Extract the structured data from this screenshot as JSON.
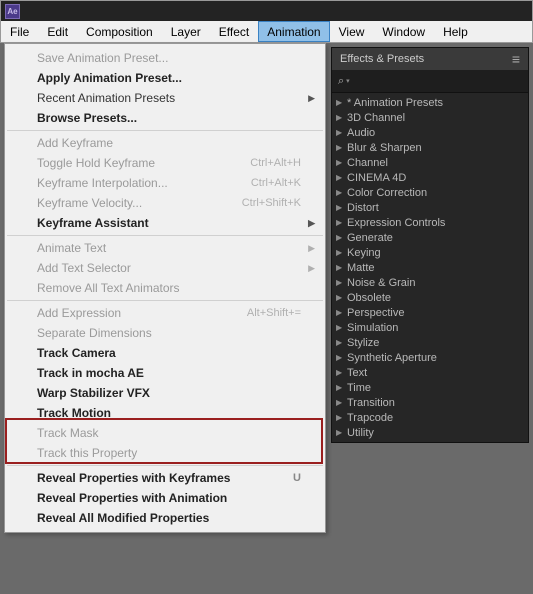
{
  "app_icon": "Ae",
  "menubar": {
    "items": [
      "File",
      "Edit",
      "Composition",
      "Layer",
      "Effect",
      "Animation",
      "View",
      "Window",
      "Help"
    ],
    "active_index": 5
  },
  "dropdown": {
    "groups": [
      [
        {
          "label": "Save Animation Preset...",
          "disabled": true
        },
        {
          "label": "Apply Animation Preset...",
          "bold": true
        },
        {
          "label": "Recent Animation Presets",
          "submenu": true
        },
        {
          "label": "Browse Presets...",
          "bold": true
        }
      ],
      [
        {
          "label": "Add Keyframe",
          "disabled": true
        },
        {
          "label": "Toggle Hold Keyframe",
          "disabled": true,
          "shortcut": "Ctrl+Alt+H"
        },
        {
          "label": "Keyframe Interpolation...",
          "disabled": true,
          "shortcut": "Ctrl+Alt+K"
        },
        {
          "label": "Keyframe Velocity...",
          "disabled": true,
          "shortcut": "Ctrl+Shift+K"
        },
        {
          "label": "Keyframe Assistant",
          "bold": true,
          "submenu": true
        }
      ],
      [
        {
          "label": "Animate Text",
          "disabled": true,
          "submenu": true
        },
        {
          "label": "Add Text Selector",
          "disabled": true,
          "submenu": true
        },
        {
          "label": "Remove All Text Animators",
          "disabled": true
        }
      ],
      [
        {
          "label": "Add Expression",
          "disabled": true,
          "shortcut": "Alt+Shift+="
        },
        {
          "label": "Separate Dimensions",
          "disabled": true
        },
        {
          "label": "Track Camera",
          "bold": true
        },
        {
          "label": "Track in mocha AE",
          "bold": true
        },
        {
          "label": "Warp Stabilizer VFX",
          "bold": true
        },
        {
          "label": "Track Motion",
          "bold": true
        },
        {
          "label": "Track Mask",
          "disabled": true
        },
        {
          "label": "Track this Property",
          "disabled": true
        }
      ],
      [
        {
          "label": "Reveal Properties with Keyframes",
          "bold": true,
          "shortcut": "U"
        },
        {
          "label": "Reveal Properties with Animation",
          "bold": true
        },
        {
          "label": "Reveal All Modified Properties",
          "bold": true
        }
      ]
    ]
  },
  "panel": {
    "title": "Effects & Presets",
    "items": [
      {
        "label": "Animation Presets",
        "special": true
      },
      {
        "label": "3D Channel"
      },
      {
        "label": "Audio"
      },
      {
        "label": "Blur & Sharpen"
      },
      {
        "label": "Channel"
      },
      {
        "label": "CINEMA 4D"
      },
      {
        "label": "Color Correction"
      },
      {
        "label": "Distort"
      },
      {
        "label": "Expression Controls"
      },
      {
        "label": "Generate"
      },
      {
        "label": "Keying"
      },
      {
        "label": "Matte"
      },
      {
        "label": "Noise & Grain"
      },
      {
        "label": "Obsolete"
      },
      {
        "label": "Perspective"
      },
      {
        "label": "Simulation"
      },
      {
        "label": "Stylize"
      },
      {
        "label": "Synthetic Aperture"
      },
      {
        "label": "Text"
      },
      {
        "label": "Time"
      },
      {
        "label": "Transition"
      },
      {
        "label": "Trapcode"
      },
      {
        "label": "Utility"
      }
    ]
  }
}
